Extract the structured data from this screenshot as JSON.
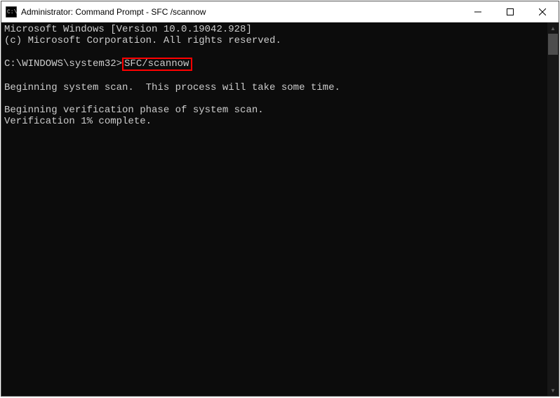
{
  "titlebar": {
    "title": "Administrator: Command Prompt - SFC /scannow"
  },
  "console": {
    "line1": "Microsoft Windows [Version 10.0.19042.928]",
    "line2": "(c) Microsoft Corporation. All rights reserved.",
    "prompt": "C:\\WINDOWS\\system32>",
    "command": "SFC/scannow",
    "line5": "Beginning system scan.  This process will take some time.",
    "line6": "Beginning verification phase of system scan.",
    "line7": "Verification 1% complete."
  }
}
